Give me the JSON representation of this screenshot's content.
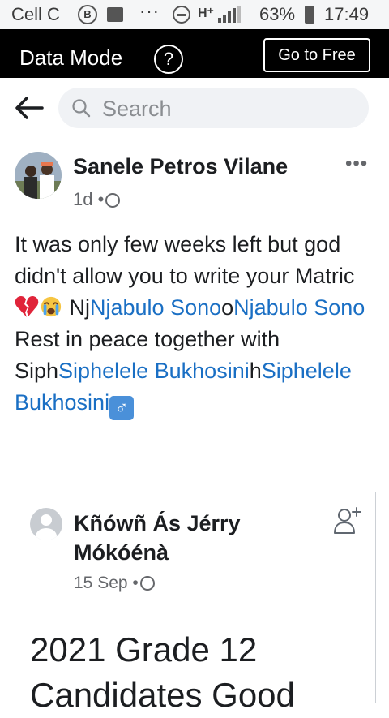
{
  "status_bar": {
    "carrier": "Cell C",
    "network": "H⁺",
    "battery_pct": "63%",
    "time": "17:49"
  },
  "data_mode_bar": {
    "label": "Data Mode",
    "help_symbol": "?",
    "go_free_label": "Go to Free"
  },
  "search": {
    "placeholder": "Search"
  },
  "post": {
    "author": "Sanele Petros Vilane",
    "age": "1d",
    "more_symbol": "•••",
    "text": {
      "p1": "It was only few weeks left but god didn't allow you to write your Matric",
      "p2": " Nj",
      "link1": "Njabulo Sono",
      "p3": "o",
      "link2": "Njabulo Sono",
      "p4": " Rest in peace together with Siph",
      "link3": "Siphelele Bukhosini",
      "p5": "h",
      "link4": "Siphelele Bukhosini",
      "emoji_male_sign": "♂"
    }
  },
  "shared_post": {
    "author": "Kñówñ Ás Jérry Mókóénà",
    "date": "15 Sep",
    "text": "2021 Grade 12",
    "text_line2": "Candidates Good"
  },
  "icons": [
    "back-arrow-icon",
    "search-icon",
    "globe-icon",
    "more-icon",
    "broken-heart-icon",
    "crying-face-icon",
    "male-sign-icon",
    "add-friend-icon"
  ]
}
